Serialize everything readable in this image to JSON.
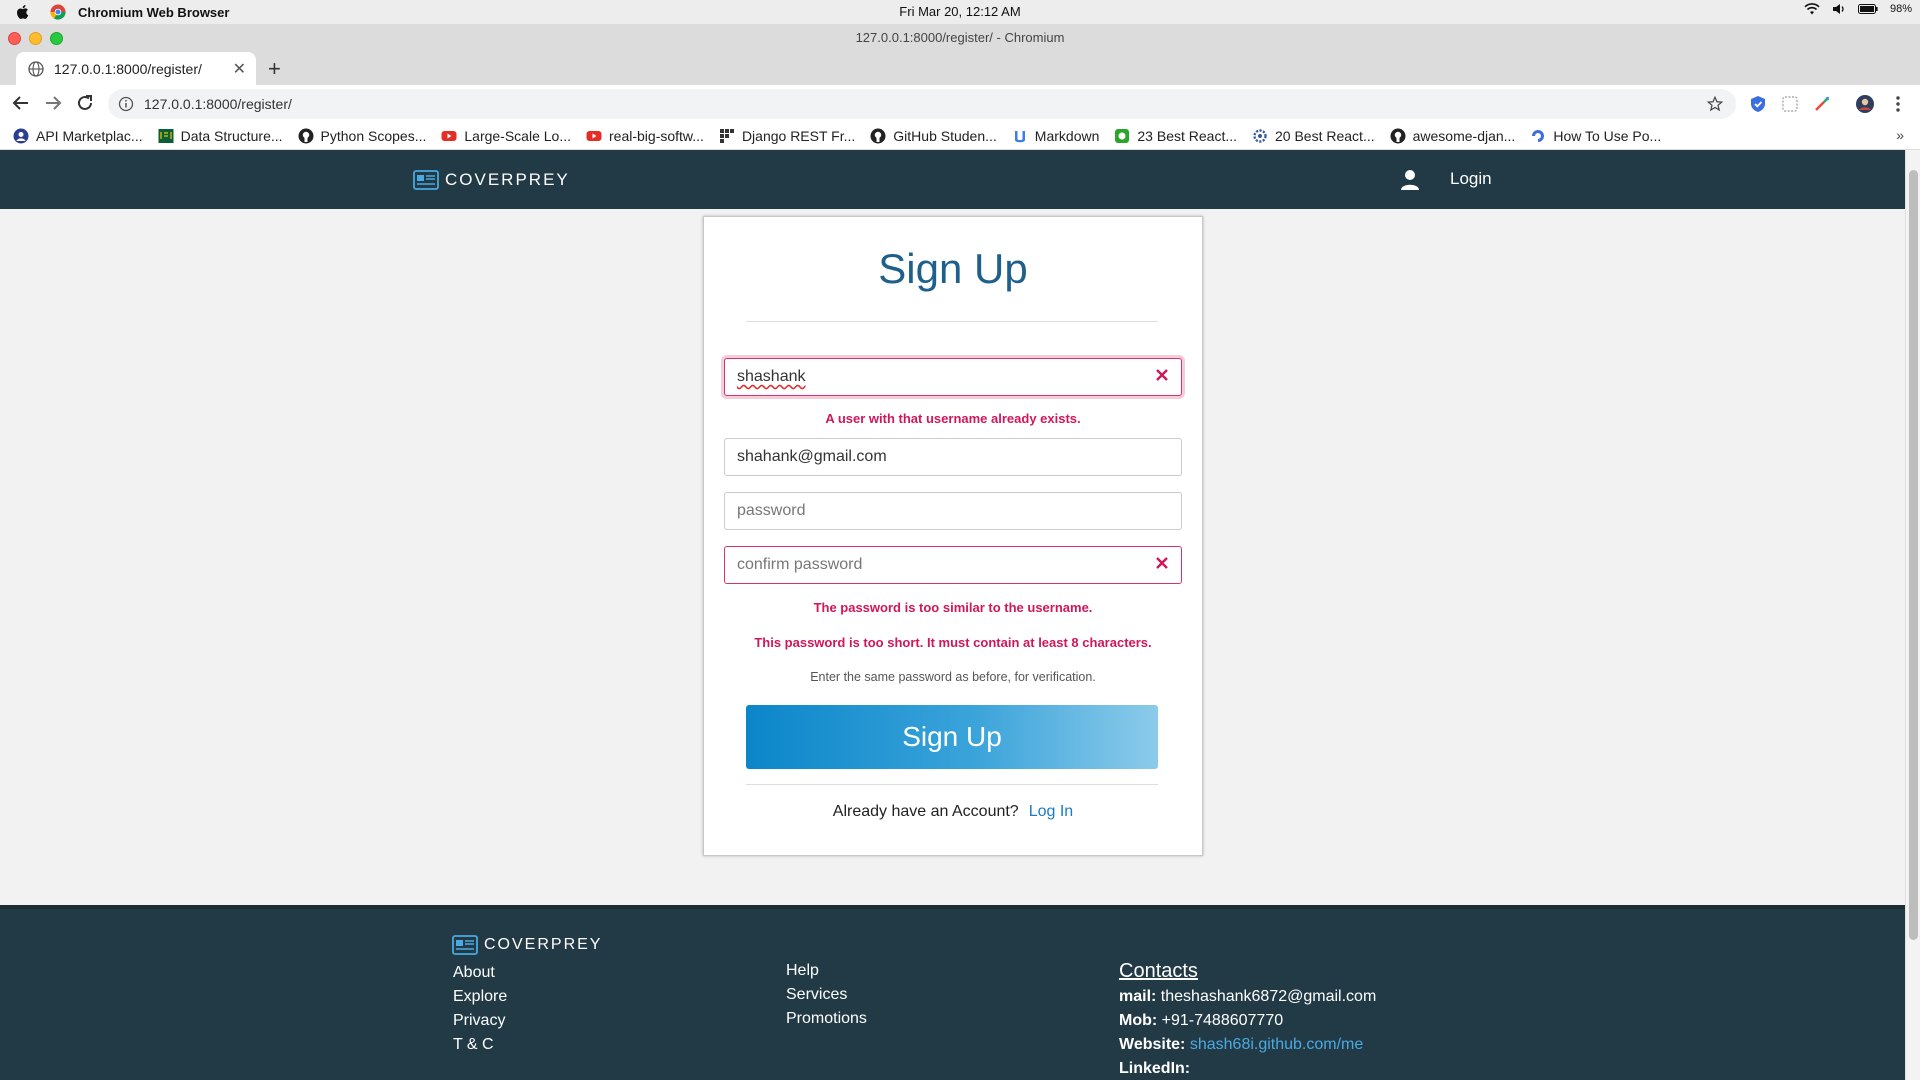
{
  "menubar": {
    "app_name": "Chromium Web Browser",
    "clock": "Fri Mar 20, 12:12 AM",
    "battery": "98%"
  },
  "window": {
    "title": "127.0.0.1:8000/register/ - Chromium"
  },
  "tab": {
    "title": "127.0.0.1:8000/register/"
  },
  "omnibox": {
    "url": "127.0.0.1:8000/register/"
  },
  "bookmarks": [
    {
      "label": "API Marketplac...",
      "icon": "rapidapi-icon",
      "color": "#2c3e8f"
    },
    {
      "label": "Data Structure...",
      "icon": "usf-icon",
      "color": "#0a5f38"
    },
    {
      "label": "Python Scopes...",
      "icon": "github-icon",
      "color": "#222222"
    },
    {
      "label": "Large-Scale Lo...",
      "icon": "youtube-icon",
      "color": "#e52d27"
    },
    {
      "label": "real-big-softw...",
      "icon": "youtube-icon",
      "color": "#e52d27"
    },
    {
      "label": "Django REST Fr...",
      "icon": "django-rest-icon",
      "color": "#333333"
    },
    {
      "label": "GitHub Studen...",
      "icon": "github-icon",
      "color": "#222222"
    },
    {
      "label": "Markdown",
      "icon": "markdown-icon",
      "color": "#3d7de5"
    },
    {
      "label": "23 Best React...",
      "icon": "react-list-icon",
      "color": "#2aa52a"
    },
    {
      "label": "20 Best React...",
      "icon": "gear-icon",
      "color": "#3b5c9c"
    },
    {
      "label": "awesome-djan...",
      "icon": "github-icon",
      "color": "#222222"
    },
    {
      "label": "How To Use Po...",
      "icon": "digitalocean-icon",
      "color": "#3d6de5"
    }
  ],
  "site": {
    "brand": "COVERPREY",
    "login_label": "Login"
  },
  "form": {
    "title": "Sign Up",
    "username_value": "shashank",
    "username_error": "A user with that username already exists.",
    "email_value": "shahank@gmail.com",
    "password_placeholder": "password",
    "confirm_placeholder": "confirm password",
    "confirm_error_1": "The password is too similar to the username.",
    "confirm_error_2": "This password is too short. It must contain at least 8 characters.",
    "confirm_help": "Enter the same password as before, for verification.",
    "submit_label": "Sign Up",
    "already_text": "Already have an Account?",
    "login_link": "Log In"
  },
  "footer": {
    "brand": "COVERPREY",
    "col1": [
      "About",
      "Explore",
      "Privacy",
      "T & C"
    ],
    "col2": [
      "Help",
      "Services",
      "Promotions"
    ],
    "contacts_heading": "Contacts",
    "mail_label": "mail:",
    "mail_value": "theshashank6872@gmail.com",
    "mob_label": "Mob:",
    "mob_value": "+91-7488607770",
    "website_label": "Website:",
    "website_value": "shash68i.github.com/me",
    "linkedin_label": "LinkedIn:"
  },
  "colors": {
    "nav_bg": "#223a45",
    "title_blue": "#1f5f8b",
    "error": "#d0175a",
    "link": "#1a7bc4"
  }
}
